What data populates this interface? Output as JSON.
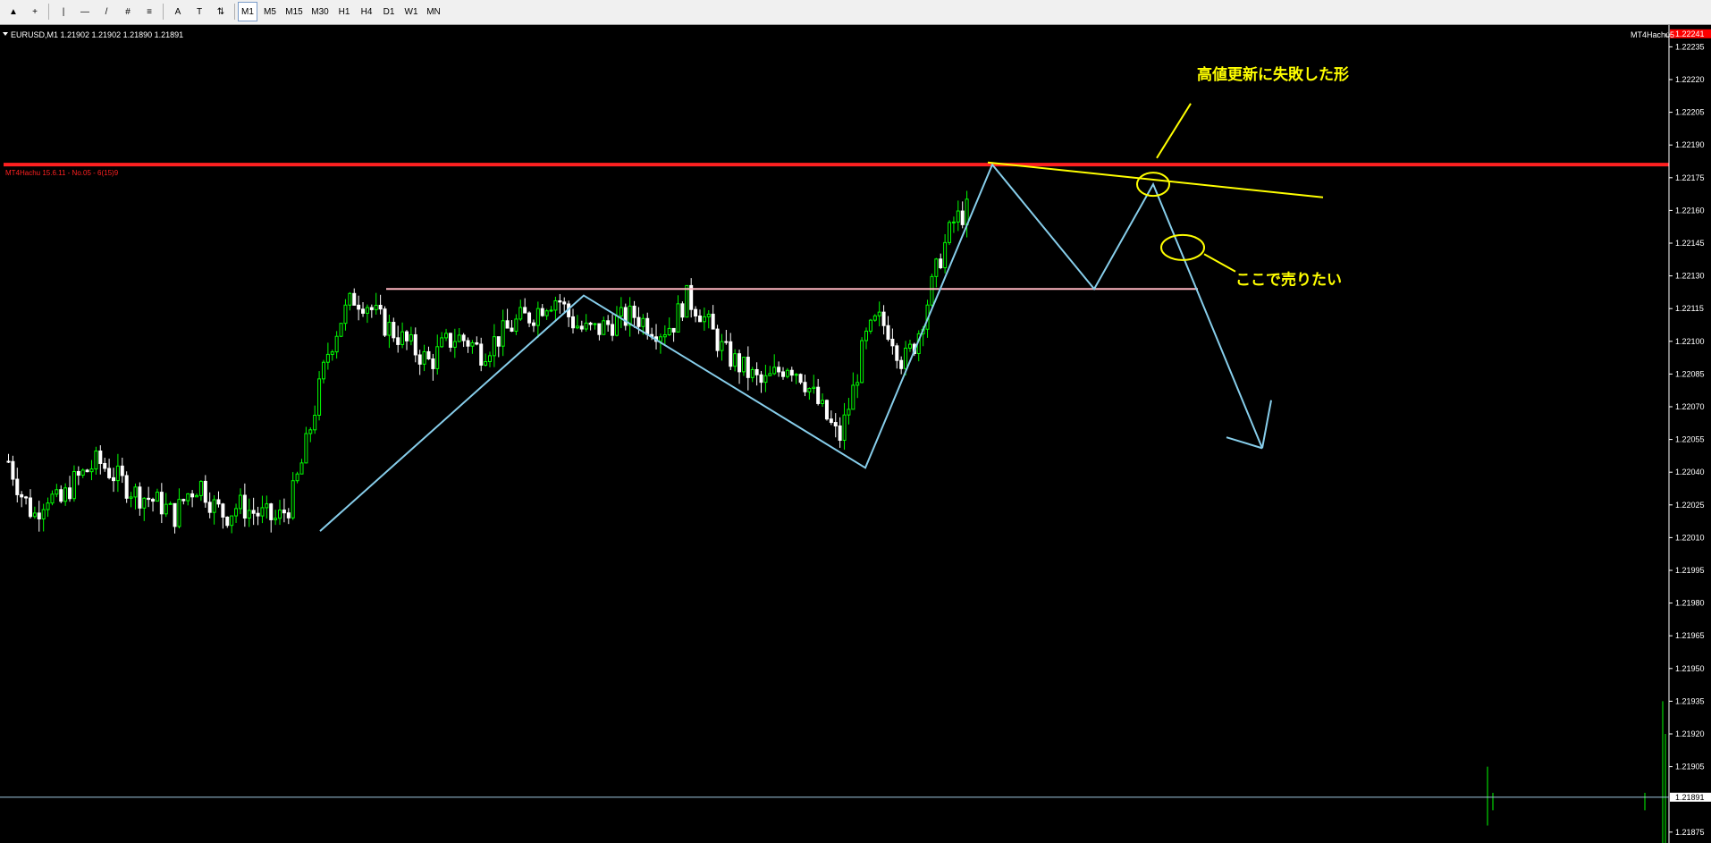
{
  "toolbar": {
    "tools": [
      {
        "name": "cursor-icon",
        "glyph": "▲"
      },
      {
        "name": "crosshair-icon",
        "glyph": "+"
      },
      {
        "name": "vertical-line-icon",
        "glyph": "|"
      },
      {
        "name": "horizontal-line-icon",
        "glyph": "—"
      },
      {
        "name": "trendline-icon",
        "glyph": "/"
      },
      {
        "name": "equidistant-channel-icon",
        "glyph": "#"
      },
      {
        "name": "fibonacci-icon",
        "glyph": "≡"
      },
      {
        "name": "text-icon",
        "glyph": "A"
      },
      {
        "name": "text-label-icon",
        "glyph": "T"
      },
      {
        "name": "arrows-icon",
        "glyph": "⇅"
      }
    ],
    "timeframes": [
      "M1",
      "M5",
      "M15",
      "M30",
      "H1",
      "H4",
      "D1",
      "W1",
      "MN"
    ],
    "active_timeframe": "M1"
  },
  "header": {
    "symbol_info": "EURUSD,M1  1.21902 1.21902 1.21890 1.21891",
    "expert_label": "MT4Hachu5",
    "indicator_label": "MT4Hachu 15.6.11 - No.05 - 6(15)9"
  },
  "chart_data": {
    "type": "candlestick",
    "symbol": "EURUSD",
    "timeframe": "M1",
    "ohlc_last": {
      "open": 1.21902,
      "high": 1.21902,
      "low": 1.2189,
      "close": 1.21891
    },
    "ylim": [
      1.2187,
      1.22245
    ],
    "price_ticks": [
      "1.22235",
      "1.22220",
      "1.22205",
      "1.22190",
      "1.22175",
      "1.22160",
      "1.22145",
      "1.22130",
      "1.22115",
      "1.22100",
      "1.22085",
      "1.22070",
      "1.22055",
      "1.22040",
      "1.22025",
      "1.22010",
      "1.21995",
      "1.21980",
      "1.21965",
      "1.21950",
      "1.21935",
      "1.21920",
      "1.21905",
      "1.21875"
    ],
    "current_bid_label": "1.21891",
    "current_bid": 1.21891,
    "top_marker_label": "1.22241",
    "top_marker": 1.22241,
    "levels": [
      {
        "name": "resistance-line",
        "price": 1.22181,
        "color": "#ff2020"
      },
      {
        "name": "neckline",
        "price": 1.22124,
        "color": "#ffb6c1"
      }
    ],
    "candle_price_path": [
      1.22045,
      1.2203,
      1.2202,
      1.2203,
      1.22025,
      1.22035,
      1.2204,
      1.22045,
      1.2204,
      1.22035,
      1.2203,
      1.22028,
      1.22025,
      1.2202,
      1.2203,
      1.22035,
      1.22025,
      1.2202,
      1.22025,
      1.22022,
      1.2202,
      1.22018,
      1.22025,
      1.22045,
      1.2207,
      1.22095,
      1.2211,
      1.2212,
      1.22118,
      1.2211,
      1.22105,
      1.221,
      1.22095,
      1.2209,
      1.22098,
      1.22102,
      1.221,
      1.22095,
      1.221,
      1.22105,
      1.2211,
      1.22112,
      1.22118,
      1.2212,
      1.2211,
      1.22105,
      1.22105,
      1.22108,
      1.2211,
      1.22112,
      1.22108,
      1.22105,
      1.22108,
      1.2212,
      1.22115,
      1.22105,
      1.22095,
      1.2209,
      1.22085,
      1.2208,
      1.22085,
      1.2209,
      1.22085,
      1.22075,
      1.22065,
      1.22055,
      1.22075,
      1.221,
      1.2211,
      1.22105,
      1.2209,
      1.221,
      1.2212,
      1.2214,
      1.22155,
      1.2216
    ],
    "annotations": [
      {
        "name": "failed-high-label",
        "text": "高値更新に失敗した形",
        "color": "#ffff00"
      },
      {
        "name": "sell-here-label",
        "text": "ここで売りたい",
        "color": "#ffff00"
      }
    ],
    "colors": {
      "bull": "#00ff00",
      "bear": "#ffffff",
      "zigzag": "#87ceeb",
      "annotation": "#ffff00",
      "grid_text": "#ffffff"
    }
  }
}
